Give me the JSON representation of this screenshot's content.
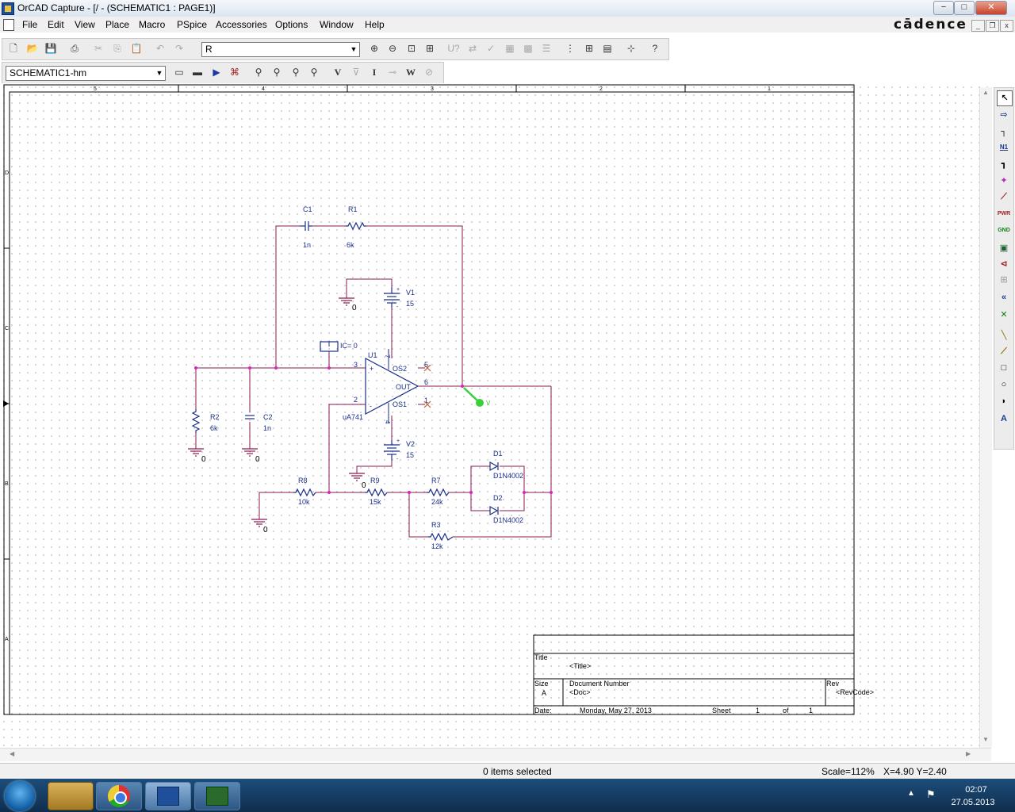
{
  "window": {
    "title": "OrCAD Capture - [/ - (SCHEMATIC1 : PAGE1)]",
    "minimize": "−",
    "maximize": "□",
    "close": "✕"
  },
  "menu": {
    "items": [
      "File",
      "Edit",
      "View",
      "Place",
      "Macro",
      "PSpice",
      "Accessories",
      "Options",
      "Window",
      "Help"
    ],
    "logo": "cādence",
    "mdi_minimize": "_",
    "mdi_restore": "❐",
    "mdi_close": "x"
  },
  "toolbar": {
    "part_search_value": "R",
    "schematic_select_value": "SCHEMATIC1-hm",
    "marker_labels": [
      "V",
      "I",
      "W"
    ]
  },
  "page_border": {
    "top_zones": [
      "5",
      "4",
      "3",
      "2",
      "1"
    ],
    "left_zones": [
      "D",
      "C",
      "B",
      "A"
    ]
  },
  "schematic": {
    "C1": {
      "ref": "C1",
      "value": "1n"
    },
    "R1": {
      "ref": "R1",
      "value": "6k"
    },
    "V1": {
      "ref": "V1",
      "value": "15"
    },
    "V2": {
      "ref": "V2",
      "value": "15"
    },
    "IC": {
      "label": "IC= 0"
    },
    "U1": {
      "ref": "U1",
      "value": "uA741",
      "pin3": "3",
      "pin2": "2",
      "pin7": "7",
      "pin4": "4",
      "pin5": "5",
      "pin6": "6",
      "pin1": "1",
      "plus": "+",
      "minus": "-",
      "os2": "OS2",
      "os1": "OS1",
      "out": "OUT",
      "vplus": "+",
      "vminus": "-"
    },
    "R2": {
      "ref": "R2",
      "value": "6k"
    },
    "C2": {
      "ref": "C2",
      "value": "1n"
    },
    "R8": {
      "ref": "R8",
      "value": "10k"
    },
    "R9": {
      "ref": "R9",
      "value": "15k"
    },
    "R7": {
      "ref": "R7",
      "value": "24k"
    },
    "R3": {
      "ref": "R3",
      "value": "12k"
    },
    "D1": {
      "ref": "D1",
      "value": "D1N4002"
    },
    "D2": {
      "ref": "D2",
      "value": "D1N4002"
    },
    "ground_label": "0",
    "probe_label": "V"
  },
  "title_block": {
    "title_label": "Title",
    "title_value": "<Title>",
    "size_label": "Size",
    "size_value": "A",
    "docnum_label": "Document Number",
    "docnum_value": "<Doc>",
    "rev_label": "Rev",
    "rev_value": "<RevCode>",
    "date_label": "Date:",
    "date_value": "Monday, May 27, 2013",
    "sheet_label": "Sheet",
    "sheet_num": "1",
    "of_label": "of",
    "sheet_total": "1"
  },
  "status": {
    "selection": "0 items selected",
    "scale": "Scale=112%",
    "coords": "X=4.90  Y=2.40"
  },
  "taskbar": {
    "time": "02:07",
    "date": "27.05.2013"
  },
  "colors": {
    "wire": "#8b1a4f",
    "part": "#1a2f8a",
    "probe": "#3ad03a",
    "nc": "#c0603a"
  }
}
